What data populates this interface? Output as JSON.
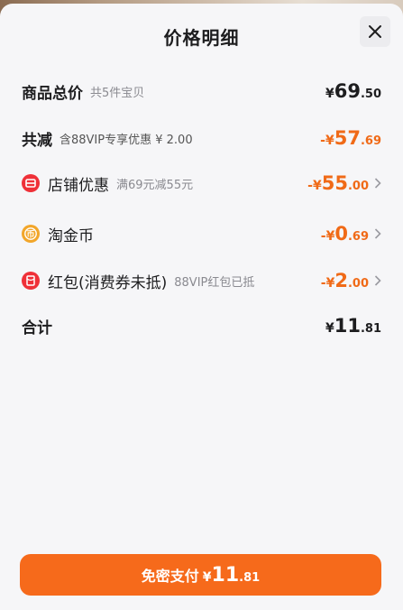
{
  "title": "价格明细",
  "rows": {
    "total": {
      "label": "商品总价",
      "sub": "共5件宝贝",
      "currency": "¥",
      "int": "69",
      "dec": ".50"
    },
    "reduce": {
      "label": "共减",
      "sub": "含88VIP专享优惠 ¥ 2.00",
      "sign": "-¥",
      "int": "57",
      "dec": ".69"
    },
    "shop": {
      "label": "店铺优惠",
      "sub": "满69元减55元",
      "sign": "-¥",
      "int": "55",
      "dec": ".00"
    },
    "coin": {
      "label": "淘金币",
      "sign": "-¥",
      "int": "0",
      "dec": ".69"
    },
    "redpacket": {
      "label": "红包(消费券未抵)",
      "sub": "88VIP红包已抵",
      "sign": "-¥",
      "int": "2",
      "dec": ".00"
    },
    "sum": {
      "label": "合计",
      "currency": "¥",
      "int": "11",
      "dec": ".81"
    }
  },
  "pay": {
    "label": "免密支付",
    "currency": "¥",
    "int": "11",
    "dec": ".81"
  },
  "icons": {
    "close": "close-icon",
    "shop": "shop-coupon-icon",
    "coin": "taojinbi-coin-icon",
    "redpacket": "red-packet-icon",
    "chevron": "chevron-right-icon"
  },
  "colors": {
    "accent": "#f06a17",
    "button": "#f66a1b",
    "text": "#1d1d1f",
    "icon_red": "#ef3038",
    "icon_gold": "#f2a62a"
  }
}
